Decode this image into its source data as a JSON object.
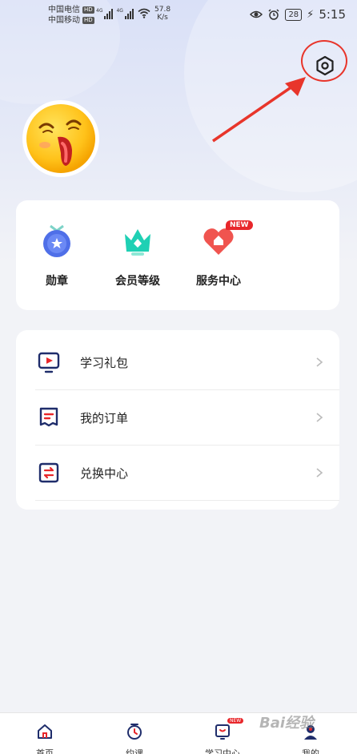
{
  "status_bar": {
    "carrier_1": "中国电信",
    "carrier_2": "中国移动",
    "hd": "HD",
    "net_speed_value": "57.8",
    "net_speed_unit": "K/s",
    "battery": "28",
    "time": "5:15"
  },
  "features": [
    {
      "label": "勋章",
      "icon": "medal-icon"
    },
    {
      "label": "会员等级",
      "icon": "crown-icon"
    },
    {
      "label": "服务中心",
      "icon": "service-heart-icon",
      "badge": "NEW"
    }
  ],
  "menu": [
    {
      "label": "学习礼包",
      "icon": "video-play-icon"
    },
    {
      "label": "我的订单",
      "icon": "order-doc-icon"
    },
    {
      "label": "兑换中心",
      "icon": "exchange-icon"
    }
  ],
  "bottom_nav": [
    {
      "label": "首页",
      "icon": "home-icon"
    },
    {
      "label": "约课",
      "icon": "clock-icon"
    },
    {
      "label": "学习中心",
      "icon": "study-icon",
      "badge": "NEW"
    },
    {
      "label": "我的",
      "icon": "profile-icon"
    }
  ],
  "watermark": "Bai经验",
  "colors": {
    "accent_red": "#e8272b",
    "navy": "#1f2d6b",
    "annotation_red": "#e8352b"
  }
}
